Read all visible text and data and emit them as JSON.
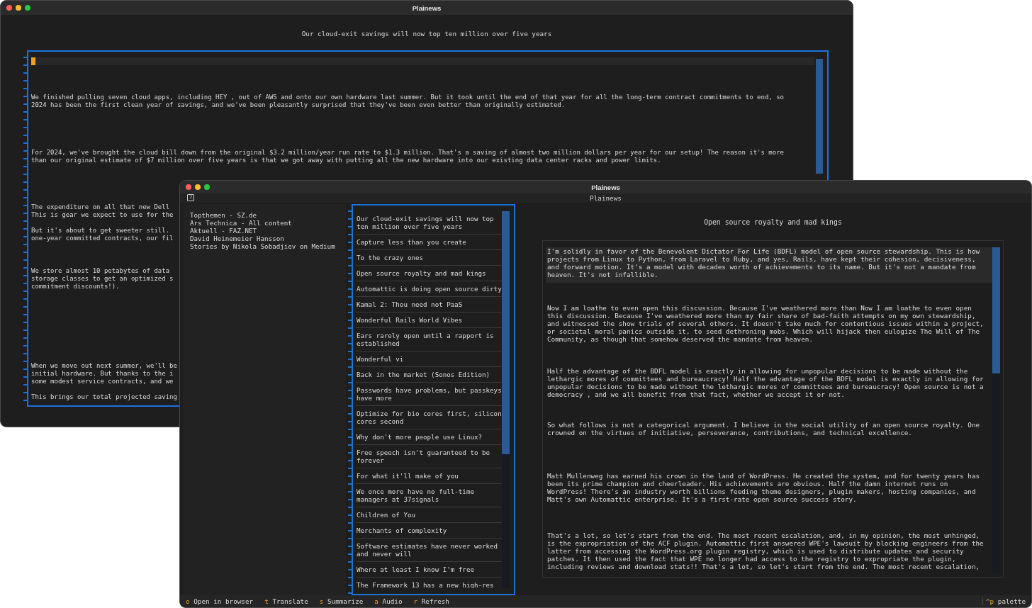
{
  "back_window": {
    "title": "Plainews",
    "article_title": "Our cloud-exit savings will now top ten million over five years",
    "paragraphs": [
      {
        "lines": [
          "We finished pulling seven cloud apps, including HEY , out of AWS and onto our own hardware last summer. But it took until the end of that year for all the long-term contract commitments to end, so",
          "2024 has been the first clean year of savings, and we've been pleasantly surprised that they've been even better than originally estimated."
        ]
      },
      {
        "lines": [
          "For 2024, we've brought the cloud bill down from the original $3.2 million/year run rate to $1.3 million. That's a saving of almost two million dollars per year for our setup! The reason it's more",
          "than our original estimate of $7 million over five years is that we got away with putting all the new hardware into our existing data center racks and power limits."
        ]
      },
      {
        "lines": [
          "The expenditure on all that new Dell",
          "This is gear we expect to use for the"
        ]
      },
      {
        "lines": [
          "But it's about to get sweeter still.",
          "one-year committed contracts, our fil"
        ]
      },
      {
        "lines": [
          "We store almost 10 petabytes of data",
          "storage classes to get an optimized s",
          "commitment discounts!)."
        ]
      },
      {
        "lines": [
          "When we move out next summer, we'll be",
          "initial hardware. But thanks to the i",
          "some modest service contracts, and we"
        ]
      },
      {
        "lines": [
          "This brings our total projected saving"
        ]
      }
    ]
  },
  "front_window": {
    "title": "Plainews",
    "help_key": "?",
    "header": "Plainews",
    "feeds": [
      {
        "name": "Topthemen - SZ.de"
      },
      {
        "name": "Ars Technica - All content"
      },
      {
        "name": "Aktuell - FAZ.NET"
      },
      {
        "name": "David Heinemeier Hansson"
      },
      {
        "name": "Stories by Nikola Sobadjiev on Medium"
      }
    ],
    "articles": [
      {
        "title": "Our cloud-exit savings will now top ten million over five years"
      },
      {
        "title": "Capture less than you create"
      },
      {
        "title": "To the crazy ones"
      },
      {
        "title": "Open source royalty and mad kings"
      },
      {
        "title": "Automattic is doing open source dirty"
      },
      {
        "title": "Kamal 2: Thou need not PaaS"
      },
      {
        "title": "Wonderful Rails World Vibes"
      },
      {
        "title": "Ears rarely open until a rapport is established"
      },
      {
        "title": "Wonderful vi"
      },
      {
        "title": "Back in the market (Sonos Edition)"
      },
      {
        "title": "Passwords have problems, but passkeys have more"
      },
      {
        "title": "Optimize for bio cores first, silicon cores second"
      },
      {
        "title": "Why don't more people use Linux?"
      },
      {
        "title": "Free speech isn't guaranteed to be forever"
      },
      {
        "title": "For what it'll make of you"
      },
      {
        "title": "We once more have no full-time managers at 37signals"
      },
      {
        "title": "Children of You"
      },
      {
        "title": "Merchants of complexity"
      },
      {
        "title": "Software estimates have never worked and never will"
      },
      {
        "title": "Where at least I know I'm free"
      },
      {
        "title": "The Framework 13 has a new high-res"
      }
    ],
    "reader": {
      "title": "Open source royalty and mad kings",
      "paragraphs": [
        "I'm solidly in favor of the Benevolent Dictator For Life (BDFL) model of open source stewardship. This is how projects from Linux to Python, from Laravel to Ruby, and yes, Rails, have kept their cohesion, decisiveness, and forward motion. It's a model with decades worth of achievements to its name. But it's not a mandate from heaven. It's not infallible.",
        "Now I am loathe to even open this discussion. Because I've weathered more than Now I am loathe to even open this discussion. Because I've weathered more than my fair share of bad-faith attempts on my own stewardship, and witnessed the show trials of several others. It doesn't take much for contentious issues within a project, or societal moral panics outside it, to seed dethroning mobs. Which will hijack then eulogize The Will of The Community, as though that somehow deserved the mandate from heaven.",
        "Half the advantage of the BDFL model is exactly in allowing for unpopular decisions to be made without the lethargic mores of committees and bureaucracy! Half the advantage of the BDFL model is exactly in allowing for unpopular decisions to be made without the lethargic mores of committees and bureaucracy! Open source is not a democracy , and we all benefit from that fact, whether we accept it or not.",
        "So what follows is not a categorical argument. I believe in the social utility of an open source royalty. One crowned on the virtues of initiative, perseverance, contributions, and technical excellence.",
        "Matt Mullenweg has earned his crown in the land of WordPress. He created the system, and for twenty years has been its prime champion and cheerleader. His achievements are obvious. Half the damn internet runs on WordPress! There's an industry worth billions feeding theme designers, plugin makers, hosting companies, and Matt's own Automattic enterprise. It's a first-rate open source success story.",
        "That's a lot, so let's start from the end. The most recent escalation, and, in my opinion, the most unhinged, is the expropriation of the ACF plugin. Automattic first answered WPE's lawsuit by blocking engineers from the latter from accessing the WordPress.org plugin registry, which is used to distribute updates and security patches. It then used the fact that WPE no longer had access to the registry to expropriate the plugin, including reviews and download stats!! That's a lot, so let's start from the end. The most recent escalation,"
      ]
    },
    "shortcuts": [
      {
        "key": "o",
        "label": "Open in browser"
      },
      {
        "key": "t",
        "label": "Translate"
      },
      {
        "key": "s",
        "label": "Summarize"
      },
      {
        "key": "a",
        "label": "Audio"
      },
      {
        "key": "r",
        "label": "Refresh"
      }
    ],
    "palette": {
      "key": "^p",
      "label": "palette"
    }
  }
}
